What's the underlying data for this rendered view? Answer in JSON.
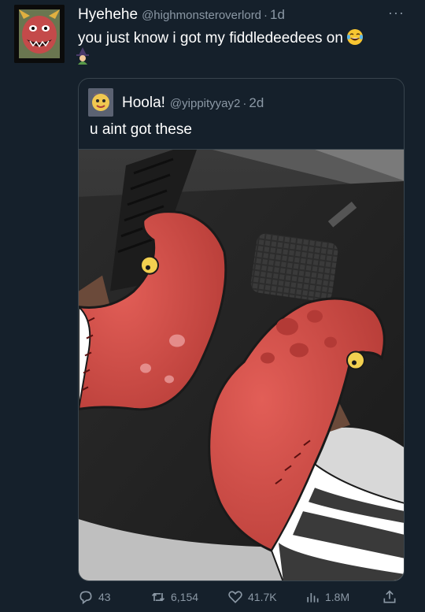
{
  "author": {
    "display_name": "Hyehehe",
    "handle": "@highmonsteroverlord",
    "time": "1d",
    "separator": "·"
  },
  "tweet": {
    "text": "you just know i got my fiddledeedees on",
    "emojis": [
      "laughing-tears-emoji",
      "witch-emoji"
    ]
  },
  "more_menu": {
    "label": "···"
  },
  "quote": {
    "display_name": "Hoola!",
    "handle": "@yippityyay2",
    "time": "2d",
    "separator": "·",
    "text": "u aint got these"
  },
  "actions": {
    "replies": "43",
    "retweets": "6,154",
    "likes": "41.7K",
    "views": "1.8M"
  },
  "colors": {
    "background": "#15202b",
    "secondary_text": "#8b98a5",
    "border": "#38444d",
    "shoe_red": "#d9504a"
  }
}
